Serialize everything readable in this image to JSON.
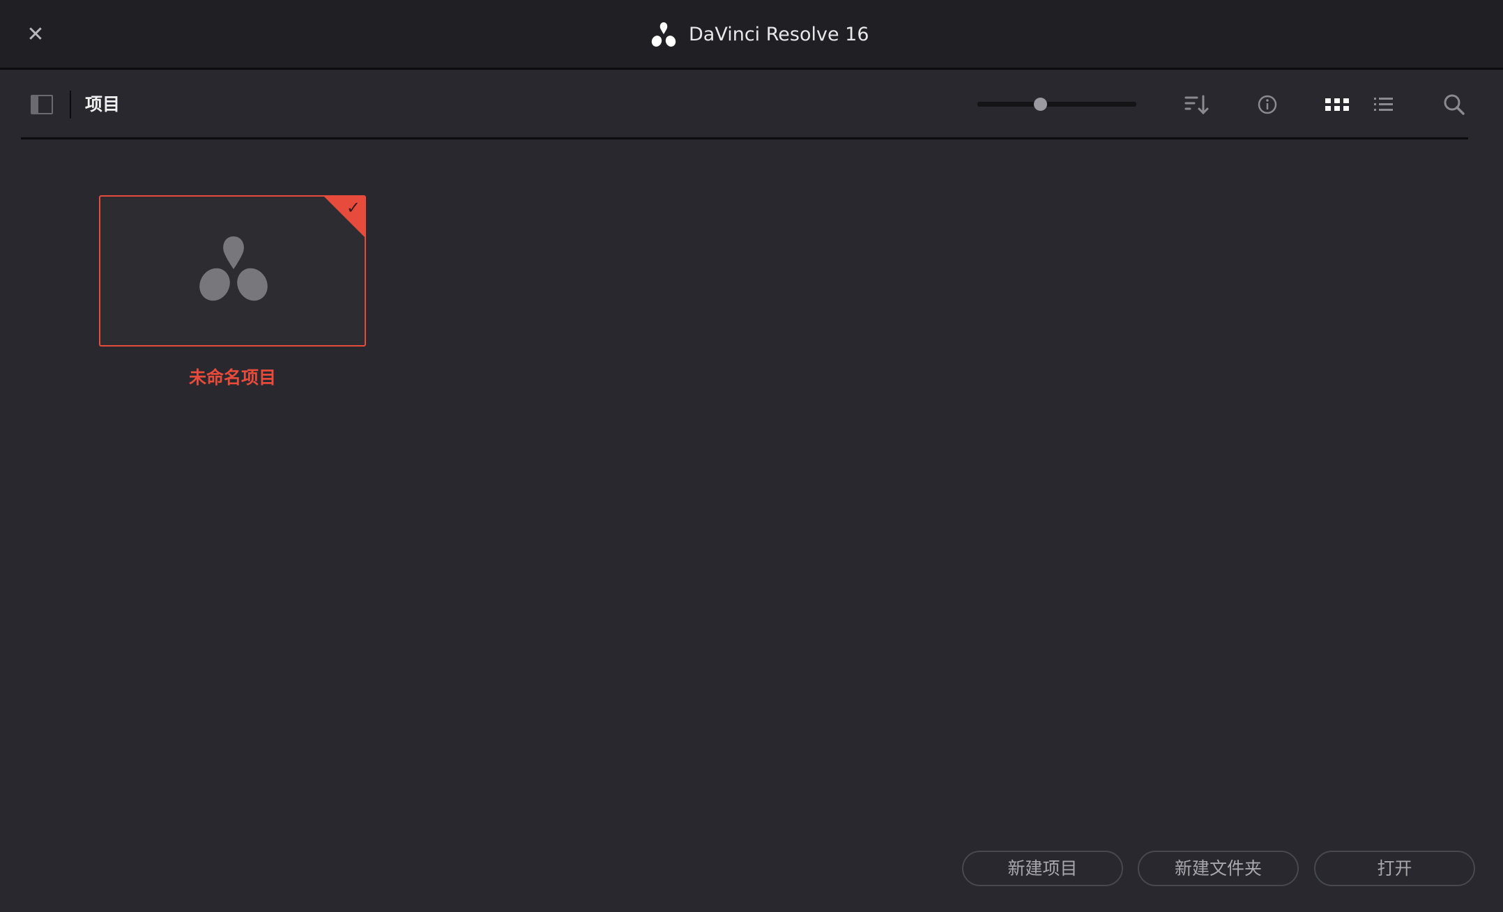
{
  "titlebar": {
    "title": "DaVinci Resolve 16",
    "close_icon": "close-icon",
    "close_glyph": "✕"
  },
  "toolbar": {
    "section_title": "项目",
    "zoom_slider_value": 0.4,
    "view_mode": "grid"
  },
  "projects": [
    {
      "name": "未命名项目",
      "selected": true
    }
  ],
  "buttons": {
    "new_project": "新建项目",
    "new_folder": "新建文件夹",
    "open": "打开"
  },
  "colors": {
    "accent": "#e64b3c",
    "background": "#28282e",
    "titlebar": "#1f1f24"
  }
}
